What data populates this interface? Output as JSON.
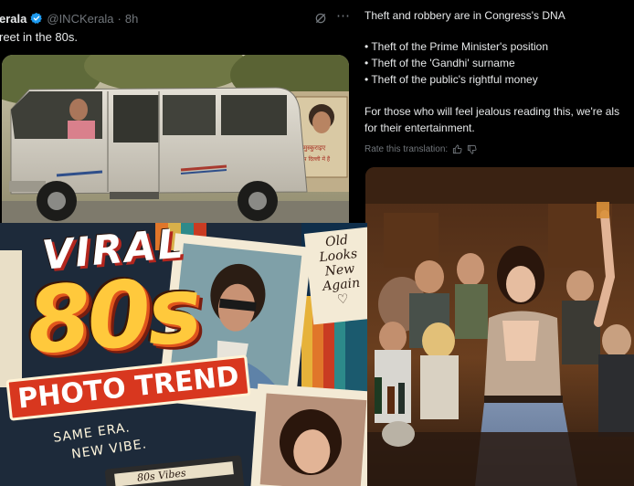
{
  "left_post": {
    "author_name": "erala",
    "handle": "@INCKerala",
    "separator": "·",
    "time": "8h",
    "text": "reet in the 80s.",
    "more_icon": "⋯",
    "icons": [
      "verified-badge-icon",
      "grok-icon",
      "more-icon"
    ]
  },
  "right_post": {
    "translation_lines": [
      "Theft and robbery are in Congress's DNA",
      "• Theft of the Prime Minister's position",
      "• Theft of the 'Gandhi' surname",
      "• Theft of the public's rightful money",
      "For those who will feel jealous reading this, we're als",
      "for their entertainment."
    ],
    "rate_label": "Rate this translation:",
    "icons": [
      "thumbs-up-icon",
      "thumbs-down-icon"
    ]
  },
  "poster": {
    "viral": "VIRAL",
    "eighties": "80s",
    "photo_trend": "PHOTO TREND",
    "same_era": "SAME ERA.",
    "new_vibe": "NEW VIBE.",
    "old_looks": "Old Looks New Again",
    "heart": "♡",
    "tag": "80s Vibes"
  },
  "van_sign": {
    "line1": "मुस्कुराइए",
    "line2": "आप दिल्ली में हैं"
  },
  "colors": {
    "background": "#000000",
    "text": "#e7e9ea",
    "muted": "#71767b",
    "verified": "#1d9bf0",
    "poster_yellow": "#ffc93c",
    "poster_red": "#d8371f"
  }
}
